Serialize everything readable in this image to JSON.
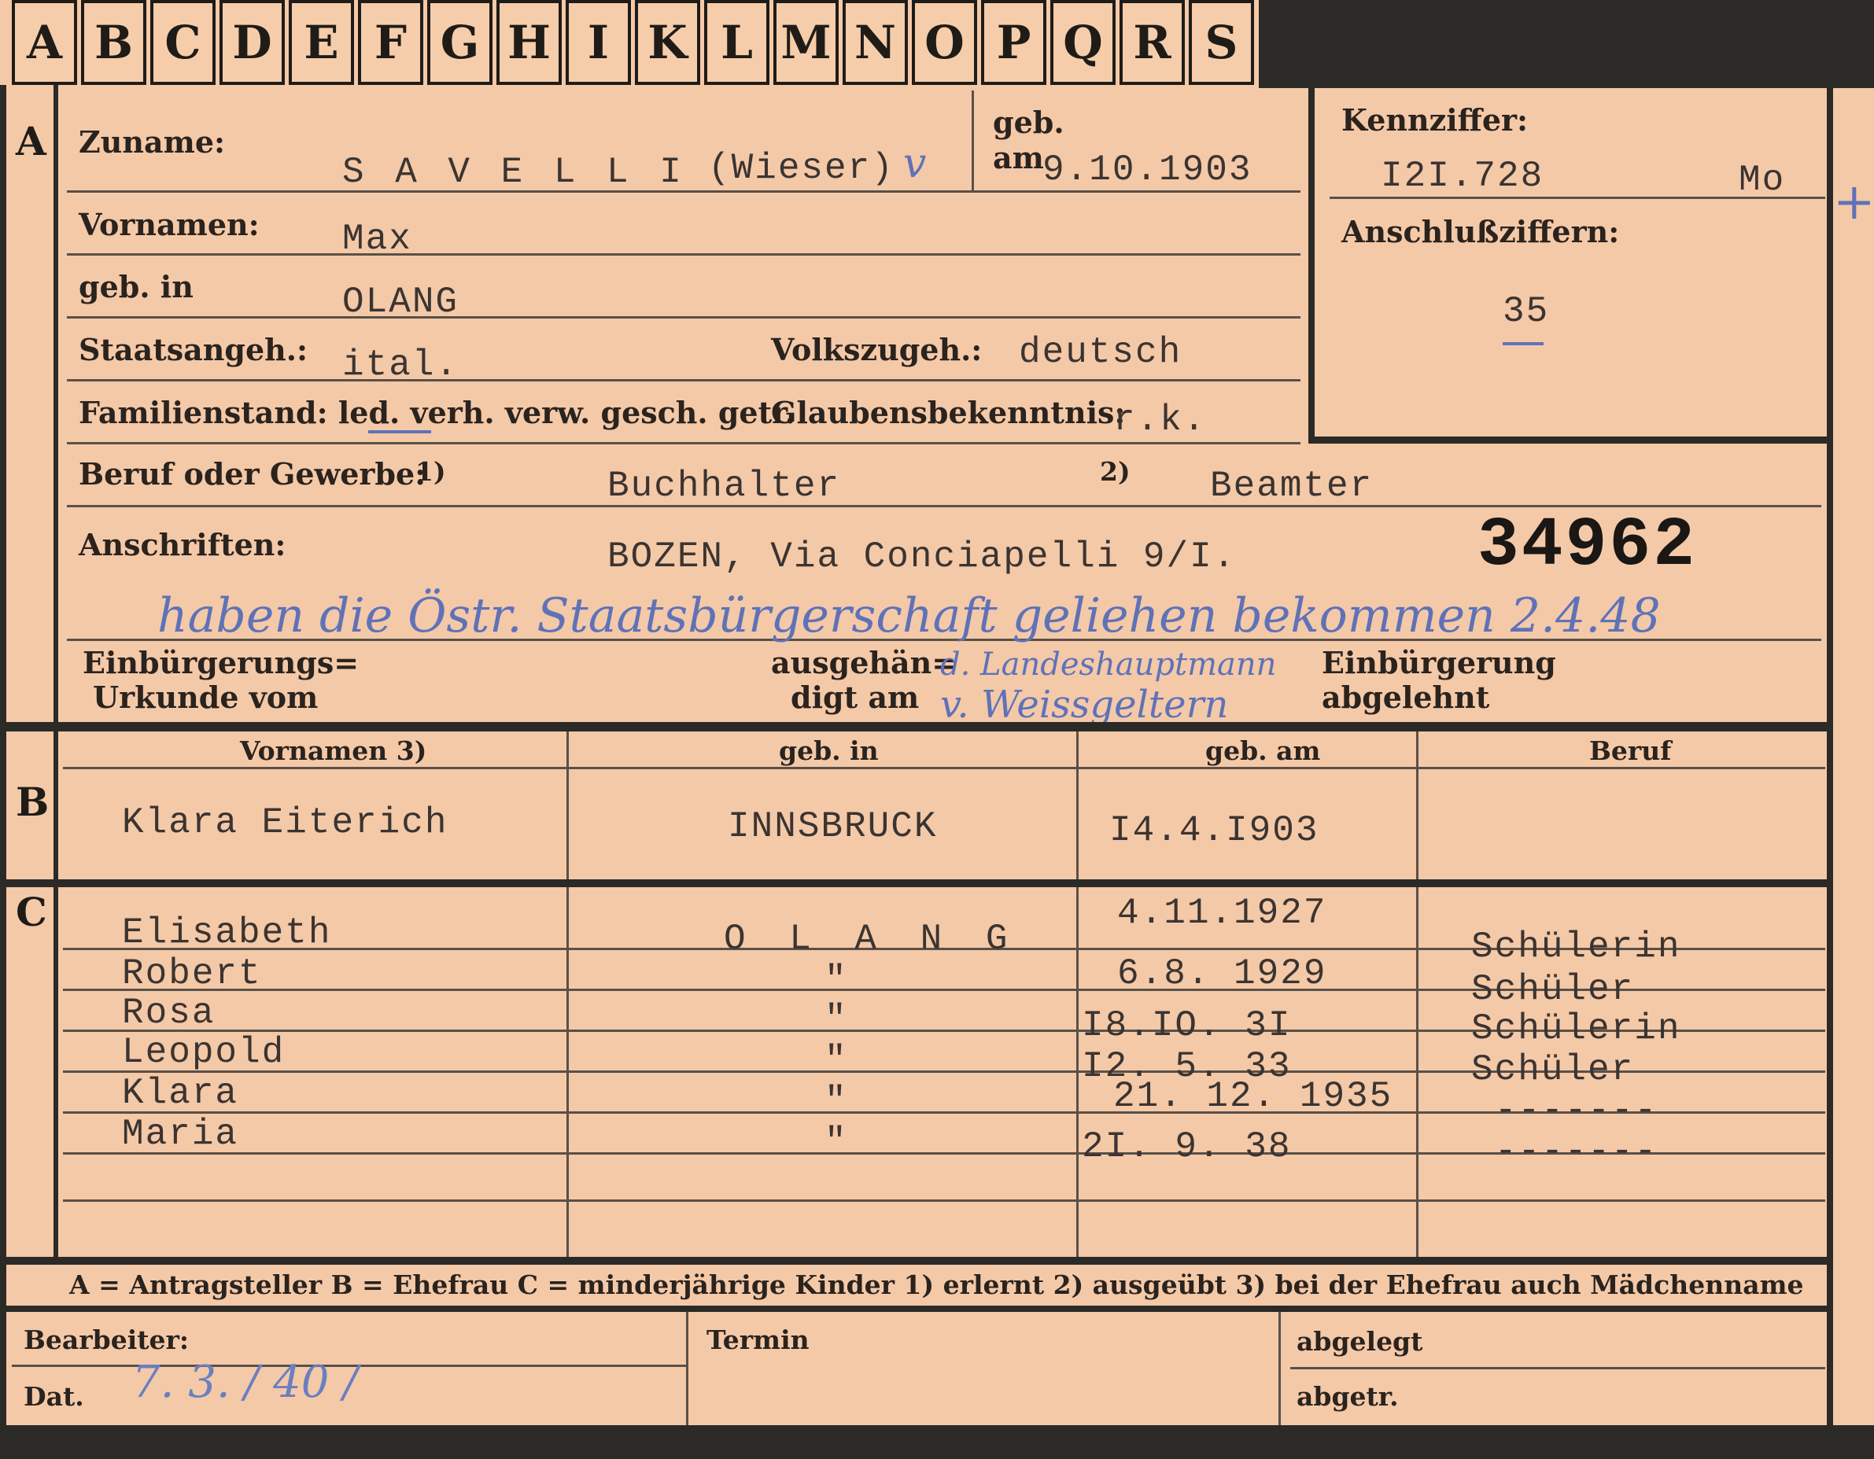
{
  "tabs": [
    "A",
    "B",
    "C",
    "D",
    "E",
    "F",
    "G",
    "H",
    "I",
    "K",
    "L",
    "M",
    "N",
    "O",
    "P",
    "Q",
    "R",
    "S"
  ],
  "sections": {
    "a": "A",
    "b": "B",
    "c": "C"
  },
  "labels": {
    "zuname": "Zuname:",
    "geb_am_top": "geb.",
    "geb_am_bottom": "am",
    "vornamen": "Vornamen:",
    "geb_in": "geb. in",
    "staatsangeh": "Staatsangeh.:",
    "volkszugeh": "Volkszugeh.:",
    "familienstand": "Familienstand: led. verh. verw. gesch. getr.",
    "glaubensbekenntnis": "Glaubensbekenntnis:",
    "beruf": "Beruf oder Gewerbe:",
    "beruf_note1": "1)",
    "beruf_note2": "2)",
    "anschriften": "Anschriften:",
    "kennziffer": "Kennziffer:",
    "anschlussziffern": "Anschlußziffern:",
    "einbuergerung_urkunde_1": "Einbürgerungs=",
    "einbuergerung_urkunde_2": "Urkunde vom",
    "ausgehaendigt_1": "ausgehän=",
    "ausgehaendigt_2": "digt am",
    "einbuergerung_abgelehnt_1": "Einbürgerung",
    "einbuergerung_abgelehnt_2": "abgelehnt"
  },
  "person": {
    "surname": "S A V E L L I",
    "maiden": "(Wieser)",
    "check_mark": "v",
    "birth_date": "9.10.1903",
    "first_name": "Max",
    "birth_place": "OLANG",
    "citizenship": "ital.",
    "ethnicity": "deutsch",
    "religion": "r.k.",
    "profession_learned": "Buchhalter",
    "profession_practiced": "Beamter",
    "address": "BOZEN, Via Conciapelli 9/I.",
    "stamp_number": "34962"
  },
  "kennziffer": {
    "value": "I2I.728",
    "suffix": "Mo",
    "anschluss": "35"
  },
  "handwritten": {
    "note_line": "haben die Östr. Staatsbürgerschaft geliehen bekommen 2.4.48",
    "authority_1": "d. Landeshauptmann",
    "authority_2": "v. Weissgeltern",
    "date_bottom": "7. 3. / 40 /"
  },
  "spouse_headers": [
    "Vornamen 3)",
    "geb. in",
    "geb. am",
    "Beruf"
  ],
  "spouse": {
    "name": "Klara Eiterich",
    "place": "INNSBRUCK",
    "date": "I4.4.I903",
    "job": ""
  },
  "children": [
    {
      "name": "Elisabeth",
      "place": "O L A N G",
      "date": "4.11.1927",
      "job": "Schülerin"
    },
    {
      "name": "Robert",
      "place": "\"",
      "date": "6.8. 1929",
      "job": "Schüler"
    },
    {
      "name": "Rosa",
      "place": "\"",
      "date": "I8.IO.  3I",
      "job": "Schülerin"
    },
    {
      "name": "Leopold",
      "place": "\"",
      "date": "I2. 5.  33",
      "job": "Schüler"
    },
    {
      "name": "Klara",
      "place": "\"",
      "date": "21. 12. 1935",
      "job": "-------"
    },
    {
      "name": "Maria",
      "place": "\"",
      "date": "2I. 9.  38",
      "job": "-------"
    }
  ],
  "legend": "A = Antragsteller   B = Ehefrau   C = minderjährige Kinder   1) erlernt   2) ausgeübt   3) bei der Ehefrau auch Mädchenname",
  "footer": {
    "bearbeiter": "Bearbeiter:",
    "dat": "Dat.",
    "termin": "Termin",
    "abgelegt": "abgelegt",
    "abgetr": "abgetr."
  }
}
